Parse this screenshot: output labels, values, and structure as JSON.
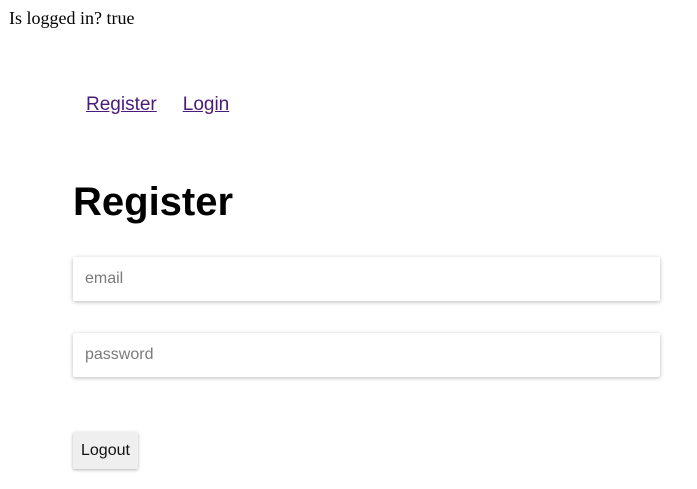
{
  "status": {
    "text": "Is logged in? true"
  },
  "nav": {
    "register_label": "Register",
    "login_label": "Login"
  },
  "main": {
    "title": "Register",
    "email_placeholder": "email",
    "email_value": "",
    "password_placeholder": "password",
    "password_value": "",
    "logout_label": "Logout"
  },
  "colors": {
    "link": "#4b1a7a",
    "button_bg": "#efefef"
  }
}
